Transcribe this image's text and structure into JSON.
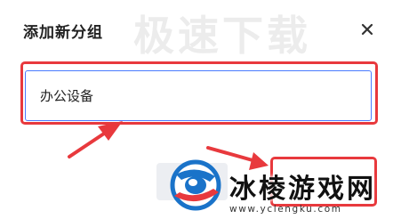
{
  "dialog": {
    "title": "添加新分组",
    "close_icon": "close-icon",
    "input_value": "办公设备"
  },
  "watermark": {
    "top_text": "极速下载",
    "brand_name": "冰棱游戏网",
    "brand_url": "www.yclengku.com"
  },
  "colors": {
    "highlight": "#e8393d",
    "input_border": "#4a7bff",
    "logo_blue": "#1a73c9"
  }
}
